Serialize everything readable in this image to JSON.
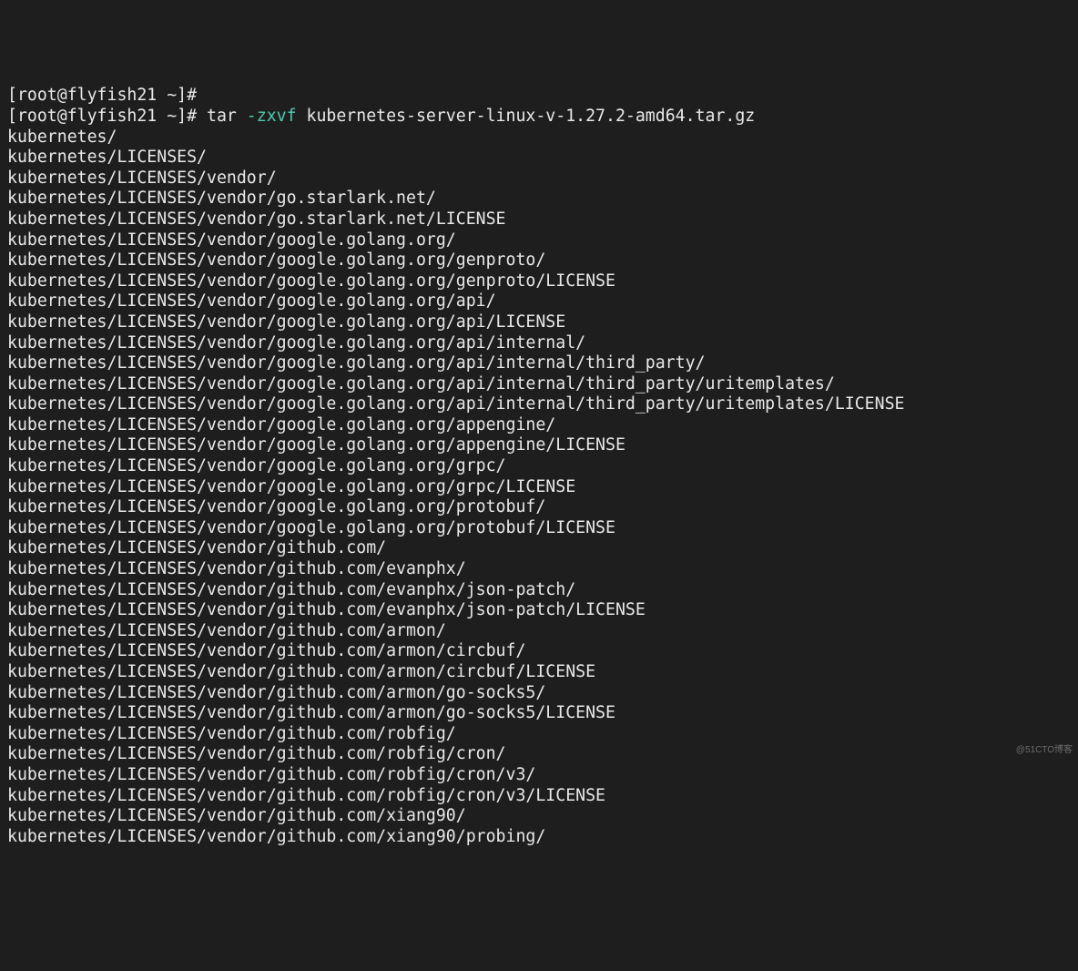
{
  "terminal": {
    "lines": [
      {
        "type": "prompt",
        "prompt": "[root@flyfish21 ~]#",
        "cmd": ""
      },
      {
        "type": "prompt",
        "prompt": "[root@flyfish21 ~]#",
        "cmd_pre": " tar ",
        "flag": "-zxvf",
        "cmd_post": " kubernetes-server-linux-v-1.27.2-amd64.tar.gz"
      },
      {
        "type": "out",
        "text": "kubernetes/"
      },
      {
        "type": "out",
        "text": "kubernetes/LICENSES/"
      },
      {
        "type": "out",
        "text": "kubernetes/LICENSES/vendor/"
      },
      {
        "type": "out",
        "text": "kubernetes/LICENSES/vendor/go.starlark.net/"
      },
      {
        "type": "out",
        "text": "kubernetes/LICENSES/vendor/go.starlark.net/LICENSE"
      },
      {
        "type": "out",
        "text": "kubernetes/LICENSES/vendor/google.golang.org/"
      },
      {
        "type": "out",
        "text": "kubernetes/LICENSES/vendor/google.golang.org/genproto/"
      },
      {
        "type": "out",
        "text": "kubernetes/LICENSES/vendor/google.golang.org/genproto/LICENSE"
      },
      {
        "type": "out",
        "text": "kubernetes/LICENSES/vendor/google.golang.org/api/"
      },
      {
        "type": "out",
        "text": "kubernetes/LICENSES/vendor/google.golang.org/api/LICENSE"
      },
      {
        "type": "out",
        "text": "kubernetes/LICENSES/vendor/google.golang.org/api/internal/"
      },
      {
        "type": "out",
        "text": "kubernetes/LICENSES/vendor/google.golang.org/api/internal/third_party/"
      },
      {
        "type": "out",
        "text": "kubernetes/LICENSES/vendor/google.golang.org/api/internal/third_party/uritemplates/"
      },
      {
        "type": "out",
        "text": "kubernetes/LICENSES/vendor/google.golang.org/api/internal/third_party/uritemplates/LICENSE"
      },
      {
        "type": "out",
        "text": "kubernetes/LICENSES/vendor/google.golang.org/appengine/"
      },
      {
        "type": "out",
        "text": "kubernetes/LICENSES/vendor/google.golang.org/appengine/LICENSE"
      },
      {
        "type": "out",
        "text": "kubernetes/LICENSES/vendor/google.golang.org/grpc/"
      },
      {
        "type": "out",
        "text": "kubernetes/LICENSES/vendor/google.golang.org/grpc/LICENSE"
      },
      {
        "type": "out",
        "text": "kubernetes/LICENSES/vendor/google.golang.org/protobuf/"
      },
      {
        "type": "out",
        "text": "kubernetes/LICENSES/vendor/google.golang.org/protobuf/LICENSE"
      },
      {
        "type": "out",
        "text": "kubernetes/LICENSES/vendor/github.com/"
      },
      {
        "type": "out",
        "text": "kubernetes/LICENSES/vendor/github.com/evanphx/"
      },
      {
        "type": "out",
        "text": "kubernetes/LICENSES/vendor/github.com/evanphx/json-patch/"
      },
      {
        "type": "out",
        "text": "kubernetes/LICENSES/vendor/github.com/evanphx/json-patch/LICENSE"
      },
      {
        "type": "out",
        "text": "kubernetes/LICENSES/vendor/github.com/armon/"
      },
      {
        "type": "out",
        "text": "kubernetes/LICENSES/vendor/github.com/armon/circbuf/"
      },
      {
        "type": "out",
        "text": "kubernetes/LICENSES/vendor/github.com/armon/circbuf/LICENSE"
      },
      {
        "type": "out",
        "text": "kubernetes/LICENSES/vendor/github.com/armon/go-socks5/"
      },
      {
        "type": "out",
        "text": "kubernetes/LICENSES/vendor/github.com/armon/go-socks5/LICENSE"
      },
      {
        "type": "out",
        "text": "kubernetes/LICENSES/vendor/github.com/robfig/"
      },
      {
        "type": "out",
        "text": "kubernetes/LICENSES/vendor/github.com/robfig/cron/"
      },
      {
        "type": "out",
        "text": "kubernetes/LICENSES/vendor/github.com/robfig/cron/v3/"
      },
      {
        "type": "out",
        "text": "kubernetes/LICENSES/vendor/github.com/robfig/cron/v3/LICENSE"
      },
      {
        "type": "out",
        "text": "kubernetes/LICENSES/vendor/github.com/xiang90/"
      },
      {
        "type": "out",
        "text": "kubernetes/LICENSES/vendor/github.com/xiang90/probing/"
      }
    ]
  },
  "watermark": "@51CTO博客"
}
